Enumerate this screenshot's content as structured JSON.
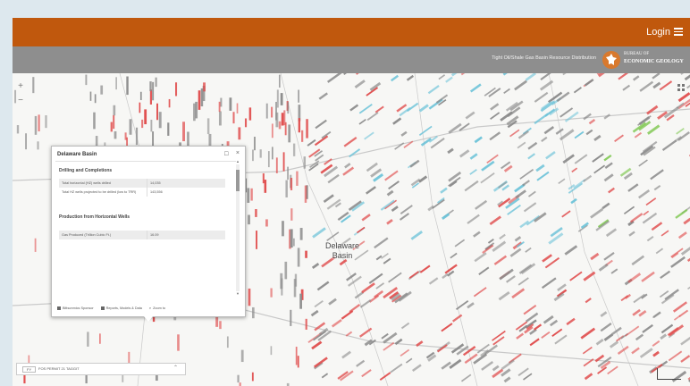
{
  "header": {
    "login_label": "Login",
    "menu_icon": "hamburger-menu-icon",
    "brand_color": "#c0580d"
  },
  "subheader": {
    "title": "Tight Oil/Shale Gas Basin Resource Distribution",
    "logo_line1": "BUREAU OF",
    "logo_line2": "ECONOMIC GEOLOGY",
    "logo_icon": "texas-star-icon"
  },
  "map": {
    "zoom_in": "+",
    "zoom_out": "−",
    "layers_icon": "layer-list-icon",
    "labels": {
      "town": "",
      "basin_line1": "Delaware",
      "basin_line2": "Basin",
      "city": "",
      "road": ""
    },
    "colors": {
      "wells_red": "#e04848",
      "wells_gray": "#8a8a8a",
      "wells_blue": "#6cc3d9",
      "wells_green": "#7ec850"
    },
    "scale": {
      "line1": "",
      "line2": ""
    }
  },
  "popup": {
    "title": "Delaware Basin",
    "maximize_icon": "maximize-icon",
    "close_icon": "close-icon",
    "sections": [
      {
        "title": "Drilling and Completions",
        "rows": [
          {
            "label": "Total horizontal (HZ) wells drilled",
            "value": "14,035"
          },
          {
            "label": "Total HZ wells projected to be drilled (low to TRR)",
            "value": "143,556"
          }
        ]
      },
      {
        "title": "Production from Horizontal Wells",
        "rows": [
          {
            "label": "Gas Produced (Trillion Cubic Ft.)",
            "value": "16.09"
          }
        ]
      }
    ],
    "actions": {
      "sponsor": "Bittsonmics Sponsor",
      "reports": "Reports, Models & Data",
      "zoom": "Zoom to"
    }
  },
  "search": {
    "prefix": "FY",
    "value": "FOS PERMIT 21 TAGGIT",
    "toggle_icon": "chevron-up-icon"
  }
}
